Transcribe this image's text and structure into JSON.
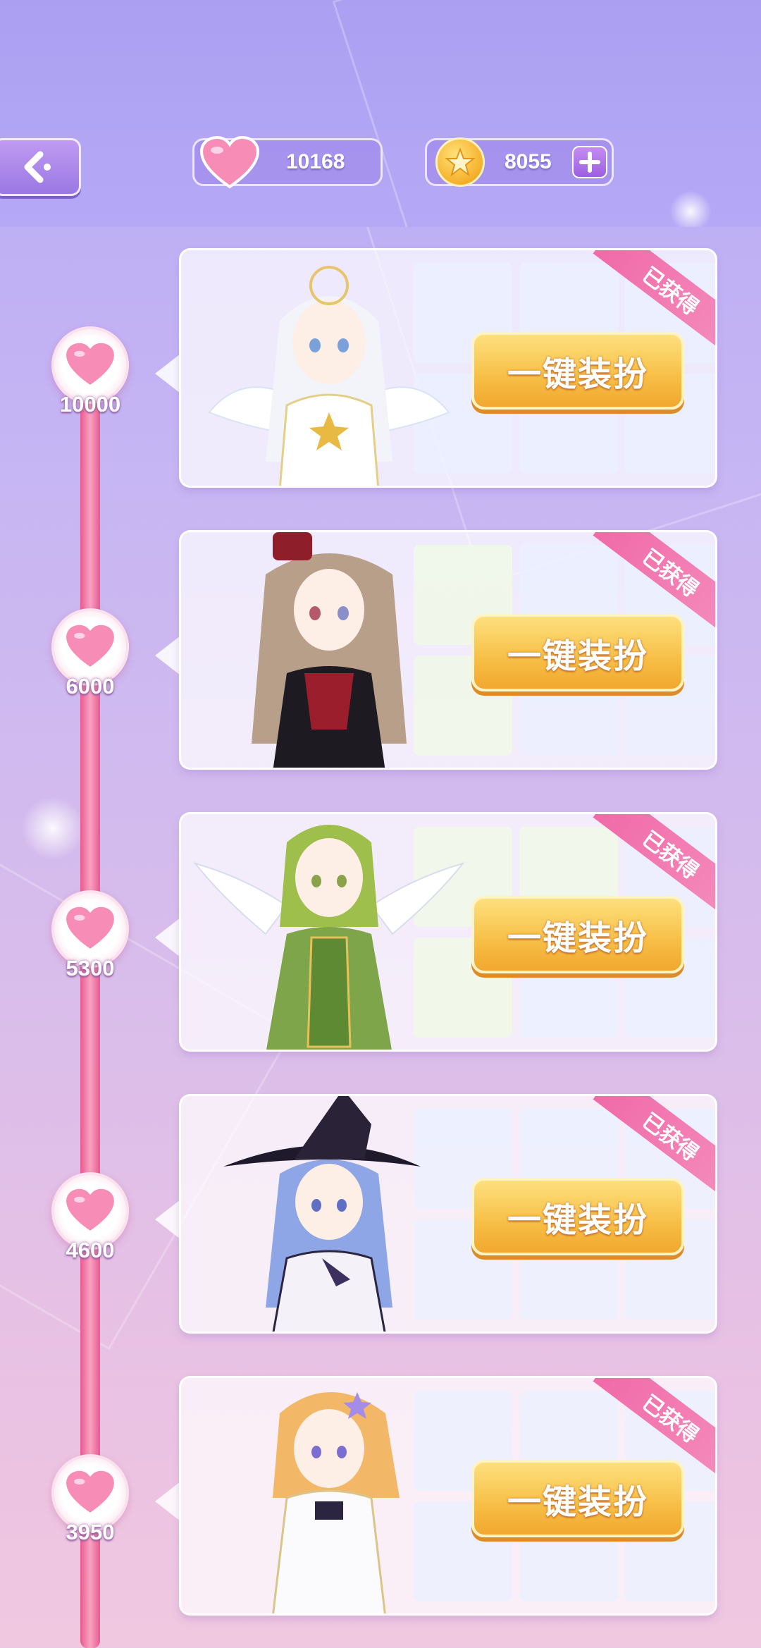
{
  "header": {
    "hearts": "10168",
    "coins": "8055"
  },
  "rewards": [
    {
      "threshold": "10000",
      "ribbon": "已获得",
      "button": "一键装扮",
      "character": "white-angel"
    },
    {
      "threshold": "6000",
      "ribbon": "已获得",
      "button": "一键装扮",
      "character": "gothic-lolita"
    },
    {
      "threshold": "5300",
      "ribbon": "已获得",
      "button": "一键装扮",
      "character": "green-fairy"
    },
    {
      "threshold": "4600",
      "ribbon": "已获得",
      "button": "一键装扮",
      "character": "purple-witch"
    },
    {
      "threshold": "3950",
      "ribbon": "已获得",
      "button": "一键装扮",
      "character": "star-idol"
    }
  ],
  "colors": {
    "accent_pink": "#f06aa8",
    "button_gold": "#f7be45",
    "header_purple": "#ab9ff2"
  },
  "icons": [
    "back-arrow-icon",
    "heart-icon",
    "gold-coin-icon",
    "plus-icon"
  ]
}
